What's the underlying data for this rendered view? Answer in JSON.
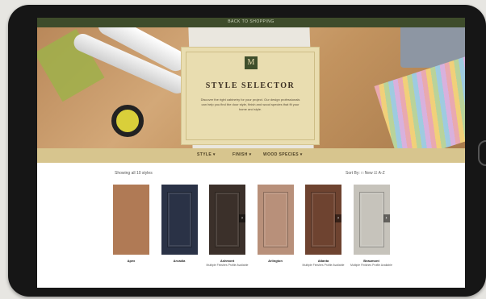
{
  "topbar": {
    "text": "BACK TO SHOPPING"
  },
  "hero": {
    "logo_letter": "M",
    "title": "STYLE SELECTOR",
    "description": "Discover the right cabinetry for your project. Our design professionals can help you find the door style, finish and wood species that fit your home and style."
  },
  "nav": {
    "items": [
      {
        "label": "STYLE"
      },
      {
        "label": "FINISH"
      },
      {
        "label": "WOOD SPECIES"
      }
    ]
  },
  "results": {
    "count_label": "Showing all 10 styles",
    "sort_label": "Sort By: □ New ☑ A-Z"
  },
  "doors": [
    {
      "name": "Apex",
      "note": "",
      "color": "#b07a55",
      "flat": true
    },
    {
      "name": "Arcadia",
      "note": "",
      "color": "#2a3246",
      "flat": false
    },
    {
      "name": "Ashmont",
      "note": "Multiple Finishes Profile Available",
      "color": "#3b302a",
      "flat": false
    },
    {
      "name": "Arlington",
      "note": "",
      "color": "#b8907a",
      "flat": false
    },
    {
      "name": "Atlanta",
      "note": "Multiple Finishes Profile Available",
      "color": "#6e4330",
      "flat": false
    },
    {
      "name": "Beaumont",
      "note": "Multiple Finishes Profile Available",
      "color": "#c6c3bb",
      "flat": false
    }
  ],
  "colors": {
    "accent": "#3e4c2b",
    "nav_bg": "#d7c58e",
    "panel_bg": "#e9ddb0"
  },
  "icons": {
    "arrow_right": "›"
  }
}
